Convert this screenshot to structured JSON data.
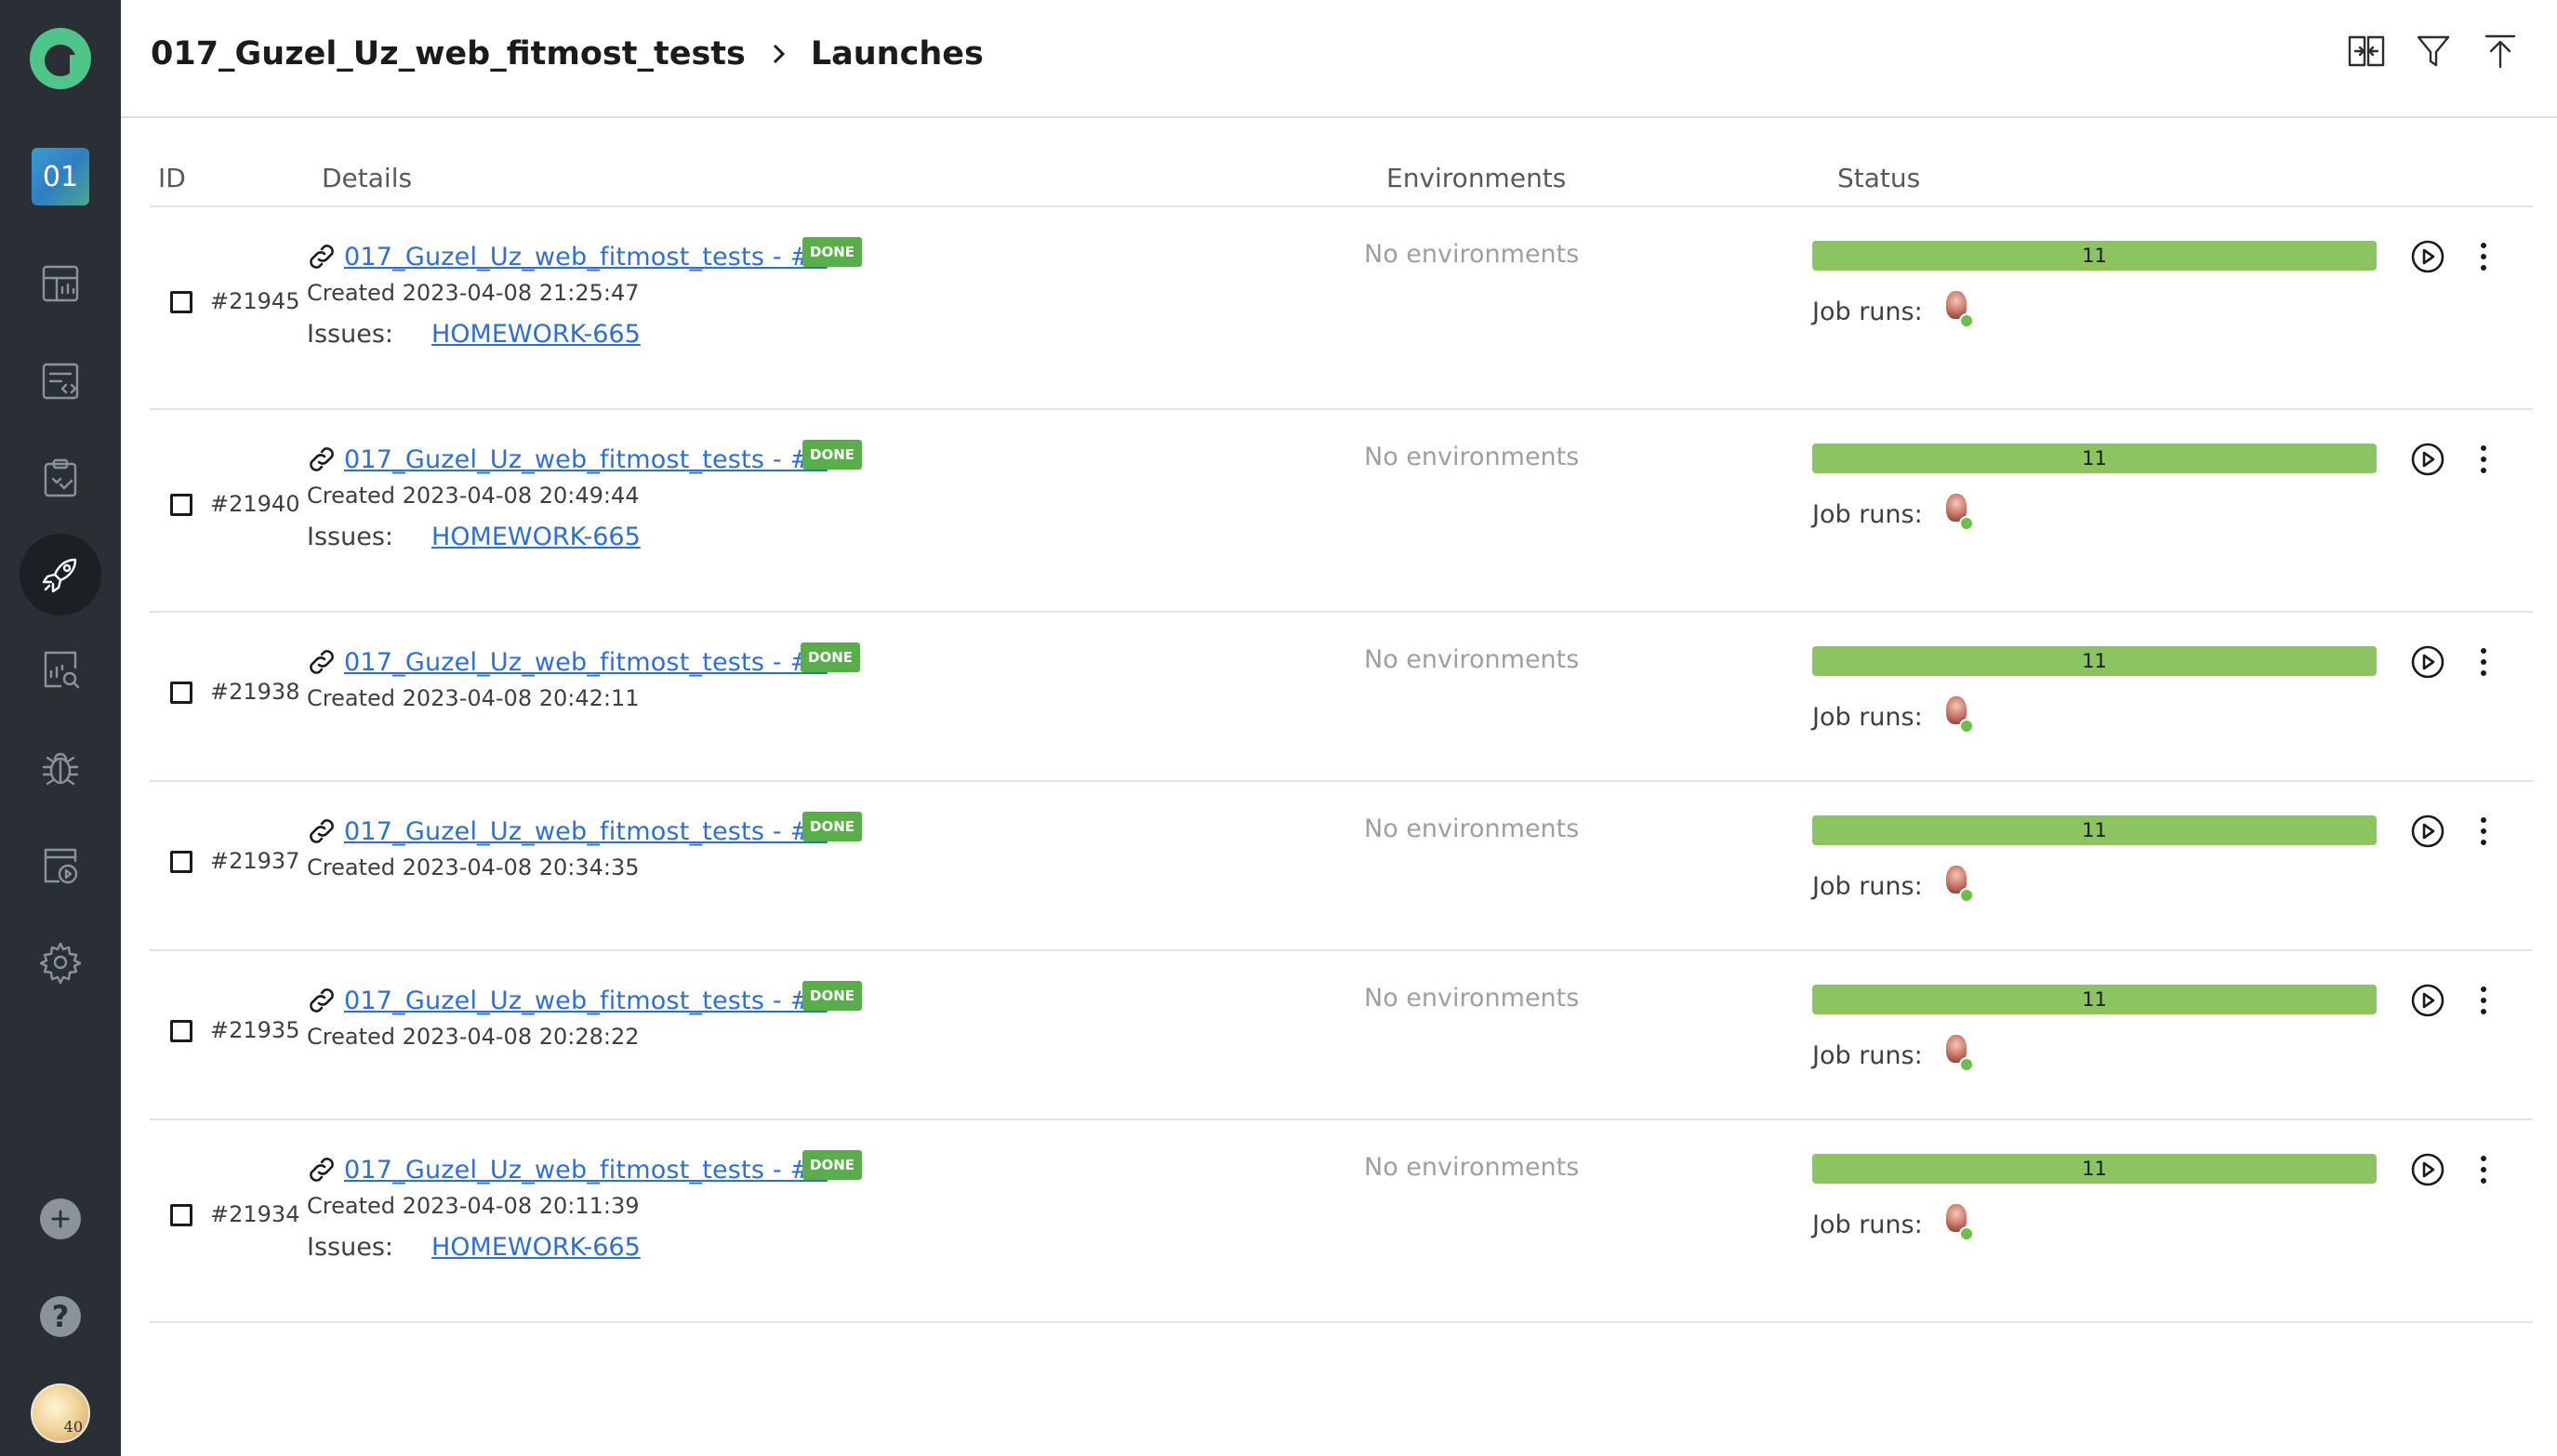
{
  "colors": {
    "sidebar_bg": "#2a2f36",
    "accent_green": "#5aae4a",
    "bar_green": "#8dc462",
    "link_blue": "#2e6fd6"
  },
  "sidebar": {
    "project_badge": "01",
    "icons": [
      "dashboard-icon",
      "test-cases-icon",
      "test-runs-icon",
      "launches-rocket-icon",
      "analytics-search-icon",
      "bug-icon",
      "scheduled-runs-icon",
      "settings-gear-icon",
      "add-project-icon",
      "help-icon"
    ],
    "avatar_text": "40"
  },
  "header": {
    "project": "017_Guzel_Uz_web_fitmost_tests",
    "page": "Launches",
    "actions": [
      "compare-icon",
      "filter-icon",
      "upload-icon"
    ]
  },
  "table": {
    "columns": {
      "id": "ID",
      "details": "Details",
      "environments": "Environments",
      "status": "Status"
    },
    "rows": [
      {
        "id": "#21945",
        "name": "017_Guzel_Uz_web_fitmost_tests - #9",
        "badge": "DONE",
        "created": "Created 2023-04-08 21:25:47",
        "issues_label": "Issues:",
        "issue": "HOMEWORK-665",
        "env": "No environments",
        "count": "11",
        "job_runs": "Job runs:"
      },
      {
        "id": "#21940",
        "name": "017_Guzel_Uz_web_fitmost_tests - #8",
        "badge": "DONE",
        "created": "Created 2023-04-08 20:49:44",
        "issues_label": "Issues:",
        "issue": "HOMEWORK-665",
        "env": "No environments",
        "count": "11",
        "job_runs": "Job runs:"
      },
      {
        "id": "#21938",
        "name": "017_Guzel_Uz_web_fitmost_tests - #7",
        "badge": "DONE",
        "created": "Created 2023-04-08 20:42:11",
        "env": "No environments",
        "count": "11",
        "job_runs": "Job runs:"
      },
      {
        "id": "#21937",
        "name": "017_Guzel_Uz_web_fitmost_tests - #6",
        "badge": "DONE",
        "created": "Created 2023-04-08 20:34:35",
        "env": "No environments",
        "count": "11",
        "job_runs": "Job runs:"
      },
      {
        "id": "#21935",
        "name": "017_Guzel_Uz_web_fitmost_tests - #5",
        "badge": "DONE",
        "created": "Created 2023-04-08 20:28:22",
        "env": "No environments",
        "count": "11",
        "job_runs": "Job runs:"
      },
      {
        "id": "#21934",
        "name": "017_Guzel_Uz_web_fitmost_tests - #4",
        "badge": "DONE",
        "created": "Created 2023-04-08 20:11:39",
        "issues_label": "Issues:",
        "issue": "HOMEWORK-665",
        "env": "No environments",
        "count": "11",
        "job_runs": "Job runs:"
      }
    ]
  }
}
